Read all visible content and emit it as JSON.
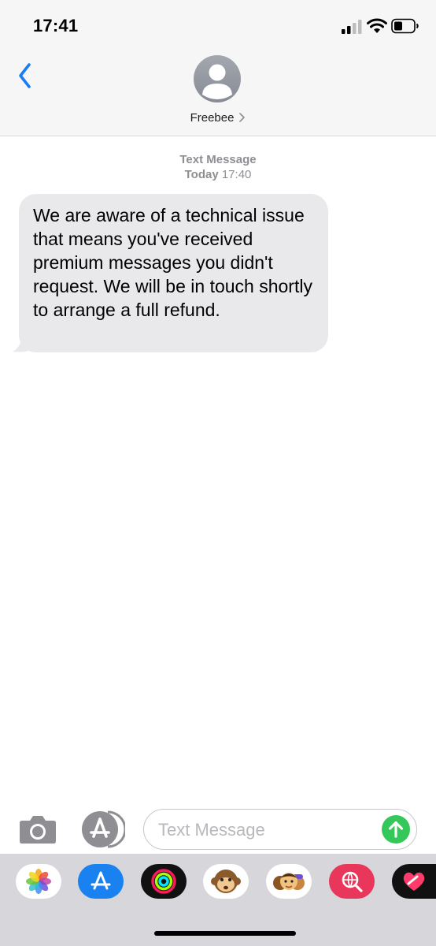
{
  "status_bar": {
    "time": "17:41",
    "icons": [
      "cellular-signal-icon",
      "wifi-icon",
      "battery-icon"
    ]
  },
  "header": {
    "back_icon": "chevron-left-icon",
    "avatar_icon": "person-silhouette-icon",
    "contact_name": "Freebee",
    "contact_chevron": "chevron-right-icon"
  },
  "conversation": {
    "service_label": "Text Message",
    "date_label": "Today",
    "time_label": "17:40",
    "messages": [
      {
        "direction": "incoming",
        "text": "We are aware of a technical issue that means you've received premium messages you didn't request. We will be in touch shortly to arrange a full refund."
      }
    ]
  },
  "compose": {
    "camera_icon": "camera-icon",
    "apps_icon": "app-store-icon",
    "placeholder": "Text Message",
    "value": "",
    "send_icon": "send-arrow-up-icon"
  },
  "app_drawer": {
    "apps": [
      "photos-icon",
      "app-store-icon",
      "activity-icon",
      "animoji-monkey-icon",
      "memoji-icon",
      "web-search-icon",
      "heart-sticker-icon"
    ]
  },
  "colors": {
    "accent_blue": "#1a7cf5",
    "bubble_gray": "#e9e9eb",
    "send_green": "#34c759",
    "secondary_text": "#8e8e93",
    "header_bg": "#f6f6f6",
    "drawer_bg": "#d6d6db"
  }
}
